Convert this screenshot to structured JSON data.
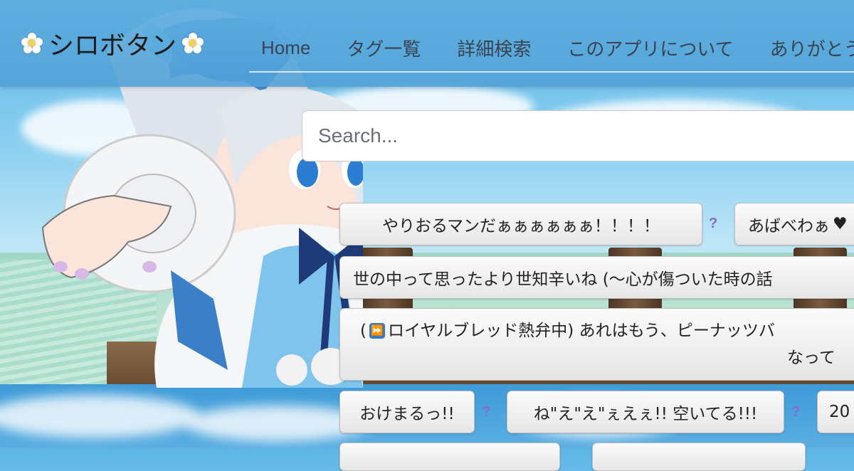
{
  "header": {
    "brand": "シロボタン",
    "nav": [
      "Home",
      "タグ一覧",
      "詳細検索",
      "このアプリについて",
      "ありがとう"
    ]
  },
  "search": {
    "placeholder": "Search..."
  },
  "voices": {
    "row1": [
      "やりおるマンだぁぁぁぁぁぁ！！！！",
      "あばべわぁ"
    ],
    "row2": [
      "世の中って思ったより世知辛いね (〜心が傷ついた時の話"
    ],
    "row3_line1_prefix": "(",
    "row3_line1": "ロイヤルブレッド熱弁中) あれはもう、ピーナッツバ",
    "row3_line2": "なって",
    "row4": [
      "おけまるっ!!",
      "ね\"え\"え\"ぇえぇ!! 空いてる!!!",
      "20"
    ]
  },
  "help_mark": "?",
  "colors": {
    "accent": "#8a6bc9",
    "nav_bar": "#5fafe1",
    "link": "#3a4450"
  },
  "icons": [
    "flower-icon",
    "fast-forward-icon"
  ]
}
